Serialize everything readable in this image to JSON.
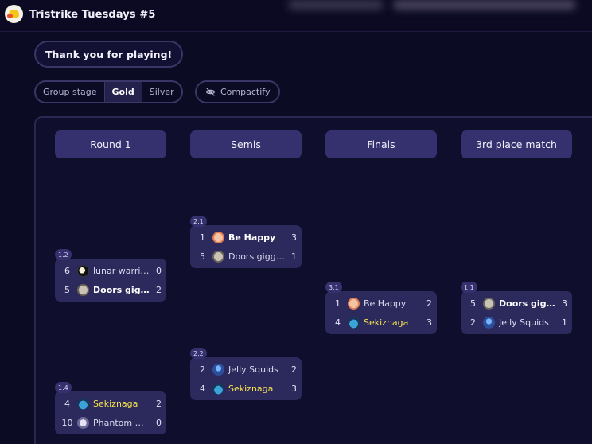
{
  "app": {
    "title": "Tristrike Tuesdays #5"
  },
  "message": "Thank you for playing!",
  "stage_tabs": [
    {
      "label": "Group stage",
      "active": false
    },
    {
      "label": "Gold",
      "active": true
    },
    {
      "label": "Silver",
      "active": false
    }
  ],
  "compact_button": {
    "label": "Compactify",
    "icon": "eye-off-icon"
  },
  "rounds": [
    {
      "label": "Round 1"
    },
    {
      "label": "Semis"
    },
    {
      "label": "Finals"
    },
    {
      "label": "3rd place match"
    }
  ],
  "matches": [
    {
      "id": "1.2",
      "teams": [
        {
          "seed": "6",
          "name": "lunar warrio...",
          "score": "0",
          "avatar": "moon-avatar",
          "winner": false,
          "highlight": false
        },
        {
          "seed": "5",
          "name": "Doors giggles",
          "score": "2",
          "avatar": "doors-avatar",
          "winner": true,
          "highlight": false
        }
      ]
    },
    {
      "id": "1.4",
      "teams": [
        {
          "seed": "4",
          "name": "Sekiznaga",
          "score": "2",
          "avatar": "sekiznaga-avatar",
          "winner": true,
          "highlight": true
        },
        {
          "seed": "10",
          "name": "Phantom Gli...",
          "score": "0",
          "avatar": "phantom-avatar",
          "winner": false,
          "highlight": false
        }
      ]
    },
    {
      "id": "2.1",
      "teams": [
        {
          "seed": "1",
          "name": "Be Happy",
          "score": "3",
          "avatar": "behappy-avatar",
          "winner": true,
          "highlight": false
        },
        {
          "seed": "5",
          "name": "Doors giggles",
          "score": "1",
          "avatar": "doors-avatar",
          "winner": false,
          "highlight": false
        }
      ]
    },
    {
      "id": "2.2",
      "teams": [
        {
          "seed": "2",
          "name": "Jelly Squids",
          "score": "2",
          "avatar": "jelly-avatar",
          "winner": false,
          "highlight": false
        },
        {
          "seed": "4",
          "name": "Sekiznaga",
          "score": "3",
          "avatar": "sekiznaga-avatar",
          "winner": true,
          "highlight": true
        }
      ]
    },
    {
      "id": "3.1",
      "teams": [
        {
          "seed": "1",
          "name": "Be Happy",
          "score": "2",
          "avatar": "behappy-avatar",
          "winner": false,
          "highlight": false
        },
        {
          "seed": "4",
          "name": "Sekiznaga",
          "score": "3",
          "avatar": "sekiznaga-avatar",
          "winner": true,
          "highlight": true
        }
      ]
    },
    {
      "id": "1.1",
      "teams": [
        {
          "seed": "5",
          "name": "Doors giggles",
          "score": "3",
          "avatar": "doors-avatar",
          "winner": true,
          "highlight": false
        },
        {
          "seed": "2",
          "name": "Jelly Squids",
          "score": "1",
          "avatar": "jelly-avatar",
          "winner": false,
          "highlight": false
        }
      ]
    }
  ],
  "colors": {
    "background": "#0c0b24",
    "card": "#2c2a5c",
    "header": "#35316e",
    "highlight": "#f4e04d"
  }
}
